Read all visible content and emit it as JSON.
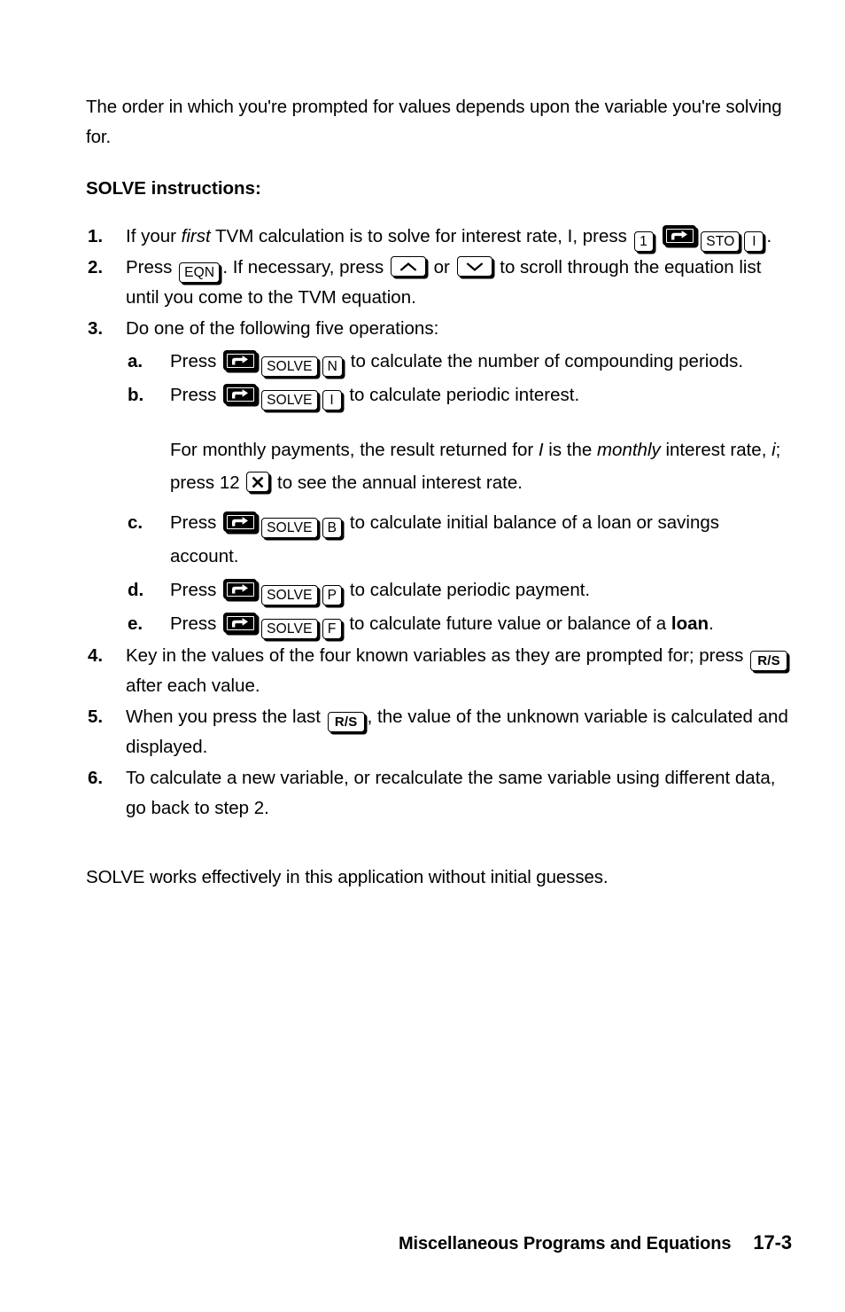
{
  "document": {
    "intro": "The order in which you're prompted for values depends upon the variable you're solving for.",
    "heading": "SOLVE instructions:",
    "closing": "SOLVE works effectively in this application without initial guesses."
  },
  "steps": [
    {
      "marker": "1.",
      "text_a": "If your ",
      "emphasis": "first",
      "text_b": " TVM calculation is to solve for interest rate, I, press ",
      "keys": [
        "1",
        "shift",
        "STO",
        "I"
      ],
      "text_c": "."
    },
    {
      "marker": "2.",
      "text_a": "Press ",
      "key_eqn": "EQN",
      "text_b": ". If necessary, press ",
      "key_up": "up-arrow",
      "text_c": " or ",
      "key_down": "down-arrow",
      "text_d": " to scroll through the equation list until you come to the TVM equation."
    },
    {
      "marker": "3.",
      "text_a": "Do one of the following five operations:"
    },
    {
      "marker": "4.",
      "text_a": "Key in the values of the four known variables as they are prompted for; press ",
      "key_rs": "R/S",
      "text_b": " after each value."
    },
    {
      "marker": "5.",
      "text_a": "When you press the last ",
      "key_rs": "R/S",
      "text_b": ", the value of the unknown variable is calculated and displayed."
    },
    {
      "marker": "6.",
      "text_a": "To calculate a new variable, or recalculate the same variable using different data, go back to step 2."
    }
  ],
  "substeps": [
    {
      "marker": "a.",
      "press": "Press",
      "key_shift": "shift",
      "key_solve": "SOLVE",
      "key_var": "N",
      "text": "to calculate the number of compounding periods."
    },
    {
      "marker": "b.",
      "press": "Press",
      "key_shift": "shift",
      "key_solve": "SOLVE",
      "key_var": "I",
      "text": "to calculate periodic interest."
    },
    {
      "marker": "c.",
      "press": "Press",
      "key_shift": "shift",
      "key_solve": "SOLVE",
      "key_var": "B",
      "text": "to calculate initial balance of a loan or savings",
      "text_line2": "account."
    },
    {
      "marker": "d.",
      "press": "Press",
      "key_shift": "shift",
      "key_solve": "SOLVE",
      "key_var": "P",
      "text": "to calculate periodic payment."
    },
    {
      "marker": "e.",
      "press": "Press",
      "key_shift": "shift",
      "key_solve": "SOLVE",
      "key_var": "F",
      "text": "to calculate future value or balance of a ",
      "text_bold": "loan",
      "text_end": "."
    }
  ],
  "note": {
    "text_a": "For monthly payments, the result returned for ",
    "italic_i_upper": "I",
    "text_b": " is the ",
    "italic_monthly": "monthly",
    "text_c": " interest rate, ",
    "italic_i_lower": "i",
    "text_d": "; press 12 ",
    "key_multiply": "×",
    "text_e": " to see the annual interest rate."
  },
  "footer": {
    "title": "Miscellaneous Programs and Equations",
    "page": "17-3"
  }
}
